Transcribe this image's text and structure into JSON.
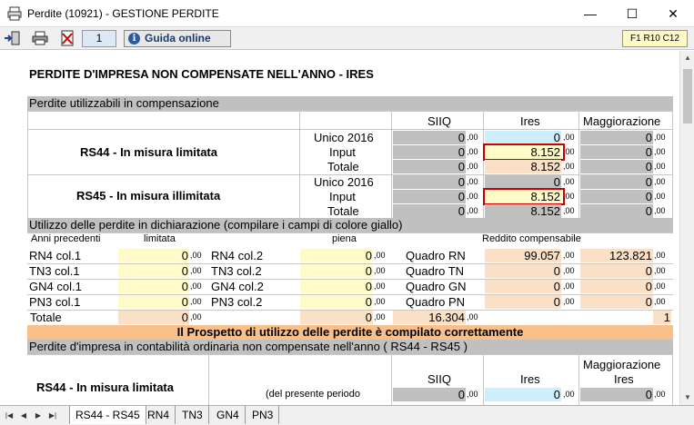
{
  "window": {
    "title": "Perdite (10921) - GESTIONE PERDITE",
    "min": "—",
    "max": "☐",
    "close": "✕"
  },
  "toolbar": {
    "page": "1",
    "guida": "Guida online",
    "info_glyph": "i",
    "cell_ref": "F1 R10 C12"
  },
  "heading": "PERDITE D'IMPRESA NON COMPENSATE NELL'ANNO - IRES",
  "section1": {
    "title": "Perdite utilizzabili in compensazione",
    "col_siiq": "SIIQ",
    "col_ires": "Ires",
    "col_magg": "Maggiorazione",
    "rs44": {
      "label": "RS44 - In misura limitata",
      "rows": [
        {
          "label": "Unico 2016",
          "siiq": "0",
          "ires": "0",
          "magg": "0"
        },
        {
          "label": "Input",
          "siiq": "0",
          "ires": "8.152",
          "magg": "0"
        },
        {
          "label": "Totale",
          "siiq": "0",
          "ires": "8.152",
          "magg": "0"
        }
      ]
    },
    "rs45": {
      "label": "RS45 - In misura illimitata",
      "rows": [
        {
          "label": "Unico 2016",
          "siiq": "0",
          "ires": "0",
          "magg": "0"
        },
        {
          "label": "Input",
          "siiq": "0",
          "ires": "8.152",
          "magg": "0"
        },
        {
          "label": "Totale",
          "siiq": "0",
          "ires": "8.152",
          "magg": "0"
        }
      ]
    },
    "dec": ",00"
  },
  "section2": {
    "title": "Utilizzo delle perdite in dichiarazione (compilare i campi di colore giallo)",
    "head_anni": "Anni precedenti",
    "head_limitata": "limitata",
    "head_piena": "piena",
    "head_reddito": "Reddito compensabile",
    "rows": [
      {
        "a": "RN4 col.1",
        "av": "0",
        "b": "RN4 col.2",
        "bv": "0",
        "q": "Quadro RN",
        "r1": "99.057",
        "r2": "123.821"
      },
      {
        "a": "TN3 col.1",
        "av": "0",
        "b": "TN3 col.2",
        "bv": "0",
        "q": "Quadro TN",
        "r1": "0",
        "r2": "0"
      },
      {
        "a": "GN4 col.1",
        "av": "0",
        "b": "GN4 col.2",
        "bv": "0",
        "q": "Quadro GN",
        "r1": "0",
        "r2": "0"
      },
      {
        "a": "PN3 col.1",
        "av": "0",
        "b": "PN3 col.2",
        "bv": "0",
        "q": "Quadro PN",
        "r1": "0",
        "r2": "0"
      }
    ],
    "totale_label": "Totale",
    "totale_lim": "0",
    "totale_pie": "0",
    "totale_tot": "16.304",
    "totale_flag": "1",
    "status": "Il Prospetto di utilizzo delle perdite è compilato correttamente"
  },
  "section3": {
    "title": "Perdite d'impresa in contabilità ordinaria non compensate nell'anno ( RS44 - RS45 )",
    "label": "RS44 - In misura limitata",
    "col_siiq": "SIIQ",
    "col_ires": "Ires",
    "col_magg1": "Maggiorazione",
    "col_magg2": "Ires",
    "row_label": "(del presente periodo",
    "siiq": "0",
    "ires": "0",
    "magg": "0"
  },
  "tabs": [
    "RS44 - RS45",
    "RN4",
    "TN3",
    "GN4",
    "PN3"
  ],
  "colors": {
    "gray": "#c0c0c0",
    "lightblue": "#cdeefb",
    "yellow": "#fffbc8",
    "peach": "#fbe0c8",
    "orange": "#f9c08c",
    "red": "#d00000"
  }
}
